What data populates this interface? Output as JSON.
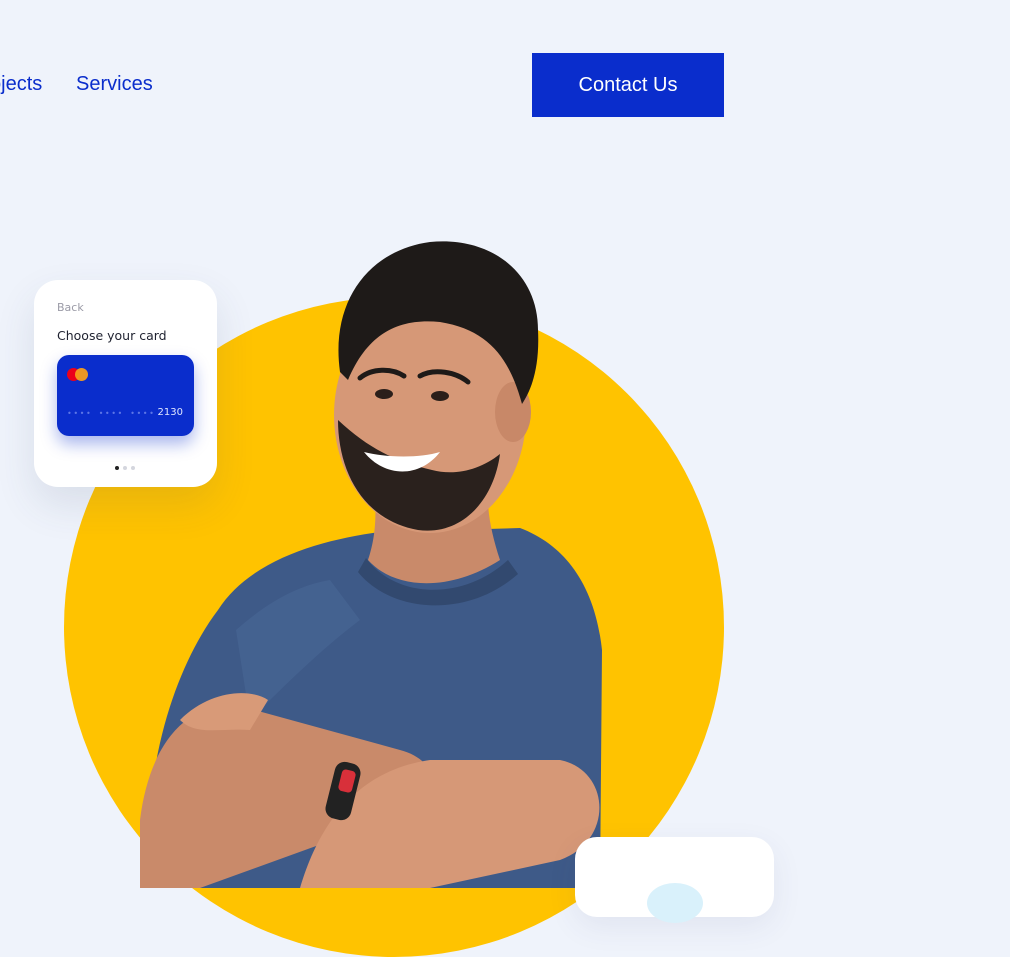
{
  "nav": {
    "projects_label": "Projects",
    "services_label": "Services",
    "contact_label": "Contact Us"
  },
  "card_widget": {
    "back_label": "Back",
    "title": "Choose your card",
    "card_number_masked": "••••  ••••  ••••",
    "card_last4": "2130",
    "pager_total": 3,
    "pager_active": 1
  },
  "colors": {
    "accent": "#0a2dcc",
    "hero_circle": "#ffc300",
    "background": "#eff3fb"
  }
}
